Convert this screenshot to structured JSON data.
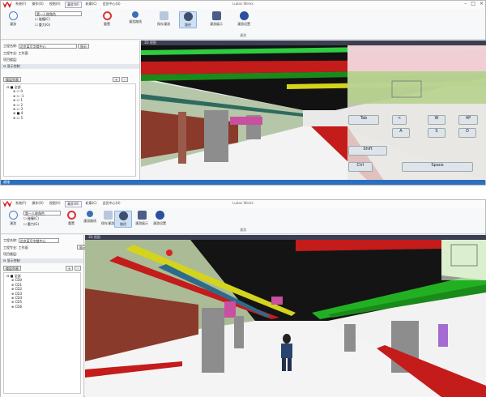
{
  "app_title": "Luban Works",
  "menu": [
    "系统(F)",
    "操作(O)",
    "视图(V)",
    "漫游(W)",
    "轮廓(C)",
    "会员中心(U)"
  ],
  "ribbon": {
    "select_value": "第一人称角色",
    "check1": "碰撞(C)",
    "check2": "重力(G)",
    "buttons": [
      "漫游",
      "重置",
      "漫游路线",
      "保存漫游",
      "路径",
      "漫游展示",
      "漫游设置"
    ],
    "group_label": "漫游"
  },
  "panel": {
    "project_label": "工程名称:",
    "project_value": "北京某写字楼中心",
    "project_button": "显示",
    "spec_label": "工程专业:",
    "spec_value": "工作面",
    "item_label": "项目楼层:",
    "display_label": "显示控制",
    "floor_list_label": "楼层列表",
    "tree_root": "全部",
    "floors_top": [
      "0",
      "-1",
      "1",
      "2",
      "3",
      "4",
      "5"
    ],
    "floors_bottom": [
      "CD0",
      "CD1",
      "CD2",
      "CD3",
      "CD4",
      "CD5",
      "CD6"
    ]
  },
  "viewport": {
    "tab": "3D 视图"
  },
  "keys": {
    "tab": "Tab",
    "w": "W",
    "a": "A",
    "s": "S",
    "d": "D",
    "shift": "Shift",
    "space": "Space",
    "ctrl": "Ctrl",
    "ir": "4P"
  },
  "status": "就绪",
  "colors": {
    "ribbon_sel": "#cfe0f3",
    "accent": "#2b6fc0"
  }
}
